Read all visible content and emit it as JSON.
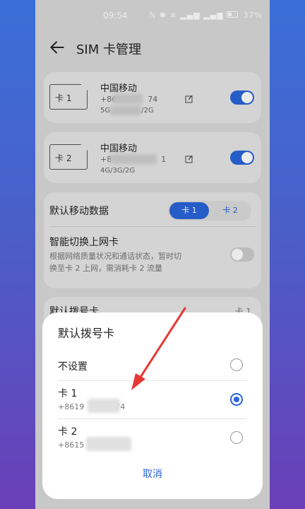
{
  "status": {
    "time": "09:54",
    "battery": "37%"
  },
  "header": {
    "title": "SIM 卡管理"
  },
  "sims": [
    {
      "slot_label": "卡 1",
      "carrier": "中国移动",
      "number_prefix": "+86",
      "number_suffix": "74",
      "network_prefix": "5G",
      "network_suffix": "/2G",
      "enabled": true
    },
    {
      "slot_label": "卡 2",
      "carrier": "中国移动",
      "number_prefix": "+8",
      "number_suffix": "1",
      "network": "4G/3G/2G",
      "enabled": true
    }
  ],
  "default_data": {
    "label": "默认移动数据",
    "options": [
      "卡 1",
      "卡 2"
    ],
    "selected": "卡 1"
  },
  "smart_switch": {
    "label": "智能切换上网卡",
    "description_line1": "根据网络质量状况和通话状态，暂时切",
    "description_line2": "换至卡 2 上网，需消耗卡 2 流量",
    "enabled": false
  },
  "default_call_row": {
    "label": "默认拨号卡",
    "value": "卡 1"
  },
  "dialog": {
    "title": "默认拨号卡",
    "options": [
      {
        "label": "不设置",
        "sub": "",
        "selected": false
      },
      {
        "label": "卡 1",
        "sub_prefix": "+8619",
        "sub_suffix": "74",
        "selected": true
      },
      {
        "label": "卡 2",
        "sub_prefix": "+8615",
        "sub_suffix": "",
        "selected": false
      }
    ],
    "cancel_label": "取消"
  },
  "colors": {
    "accent": "#2a64d9",
    "annotation_arrow": "#e53935"
  }
}
